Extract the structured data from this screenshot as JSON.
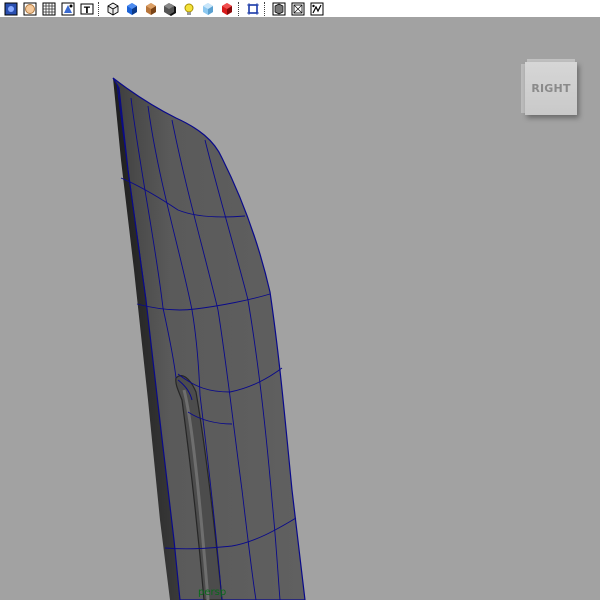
{
  "toolbar": {
    "items": [
      {
        "name": "wireframe-on-shaded",
        "icon": "wireframe-shaded-icon"
      },
      {
        "name": "xray",
        "icon": "xray-icon"
      },
      {
        "name": "wireframe",
        "icon": "wireframe-grid-icon"
      },
      {
        "name": "smooth-shade",
        "icon": "smooth-shade-icon"
      },
      {
        "name": "textured",
        "icon": "texture-t-icon"
      },
      {
        "name": "default-material",
        "icon": "material-cube-icon"
      },
      {
        "name": "shade-blue",
        "icon": "blue-cube-icon"
      },
      {
        "name": "shade-textured",
        "icon": "textured-cube-icon"
      },
      {
        "name": "shadows",
        "icon": "shadow-cube-icon"
      },
      {
        "name": "lighting",
        "icon": "light-bulb-icon"
      },
      {
        "name": "light-all",
        "icon": "light-cube-icon"
      },
      {
        "name": "render",
        "icon": "red-render-cube-icon"
      },
      {
        "name": "isolate-select",
        "icon": "isolate-icon"
      },
      {
        "name": "xray-joints",
        "icon": "xray-joints-icon"
      },
      {
        "name": "xray-components",
        "icon": "xray-components-icon"
      },
      {
        "name": "grid-toggle",
        "icon": "grid-icon"
      },
      {
        "name": "film-gate",
        "icon": "film-gate-icon"
      }
    ]
  },
  "viewcube": {
    "face_label": "RIGHT"
  },
  "viewport": {
    "camera_label": "persp",
    "background_color": "#a2a2a2",
    "mesh_color": "#5a5a5a",
    "wire_color": "#0a0a8a"
  }
}
